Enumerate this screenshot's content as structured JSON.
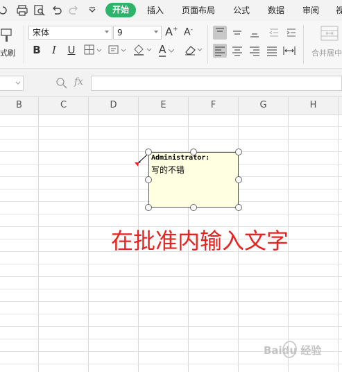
{
  "menu": {
    "tabs": [
      {
        "label": "开始",
        "active": true
      },
      {
        "label": "插入"
      },
      {
        "label": "页面布局"
      },
      {
        "label": "公式"
      },
      {
        "label": "数据"
      },
      {
        "label": "审阅"
      },
      {
        "label": "视"
      }
    ],
    "quick_access_icons": [
      "redo-icon",
      "print-icon",
      "print-preview-icon",
      "undo-icon",
      "redo-disabled-icon",
      "customize-icon"
    ]
  },
  "ribbon": {
    "format_painter_label": "式刷",
    "font_name": "宋体",
    "font_size": "9",
    "grow_font": "A",
    "shrink_font": "A",
    "bold": "B",
    "italic": "I",
    "underline": "U",
    "font_color_letter": "A",
    "merge_center_label": "合并居中"
  },
  "formula_bar": {
    "fx_label": "fx",
    "name_box_value": "",
    "formula_value": ""
  },
  "grid": {
    "columns": [
      "B",
      "C",
      "D",
      "E",
      "F",
      "G",
      "H"
    ]
  },
  "comment": {
    "author": "Administrator:",
    "text": "写的不错"
  },
  "annotation": {
    "instruction": "在批准内输入文字",
    "color": "#e8231f"
  },
  "watermark": {
    "text": "Baidu 经验"
  },
  "colors": {
    "accent": "#2db36a",
    "comment_bg": "#ffffe1"
  }
}
